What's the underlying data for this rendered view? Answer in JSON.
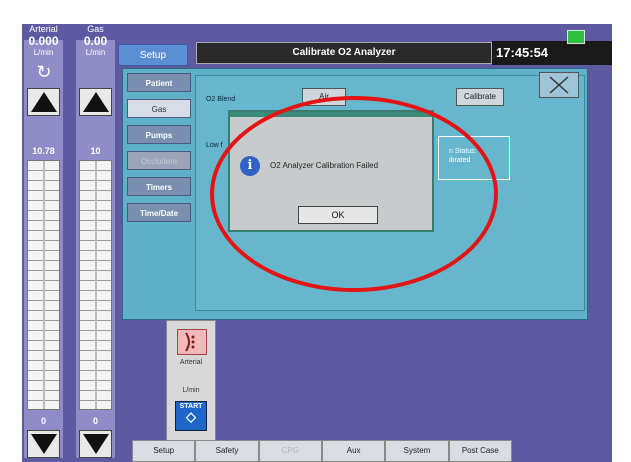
{
  "left_columns": [
    {
      "header_name": "Arterial",
      "readout": "0.000",
      "unit": "L/min",
      "value": "10.78",
      "bottom_value": "0"
    },
    {
      "header_name": "Gas",
      "readout": "0.00",
      "unit": "L/min",
      "value": "10",
      "bottom_value": "0"
    }
  ],
  "header": {
    "setup_tab": "Setup",
    "title": "Calibrate O2 Analyzer",
    "clock": "17:45:54"
  },
  "menu": [
    {
      "label": "Patient",
      "state": "normal"
    },
    {
      "label": "Gas",
      "state": "active"
    },
    {
      "label": "Pumps",
      "state": "normal"
    },
    {
      "label": "Occluders",
      "state": "disabled"
    },
    {
      "label": "Timers",
      "state": "normal"
    },
    {
      "label": "Time/Date",
      "state": "normal"
    }
  ],
  "gas_panel": {
    "o2_blender_label": "O2 Blend",
    "air_button": "Air",
    "calibrate_button": "Calibrate",
    "low_label": "Low f",
    "status_line1": "n Status:",
    "status_line2": "ibrated"
  },
  "dialog": {
    "message": "O2 Analyzer Calibration Failed",
    "ok_button": "OK",
    "icon": "info-icon"
  },
  "pump": {
    "label": "Arterial",
    "unit": "L/min",
    "start_label": "START"
  },
  "bottom_tabs": [
    {
      "label": "Setup",
      "state": "normal"
    },
    {
      "label": "Safety",
      "state": "normal"
    },
    {
      "label": "CPG",
      "state": "disabled"
    },
    {
      "label": "Aux",
      "state": "normal"
    },
    {
      "label": "System",
      "state": "normal"
    },
    {
      "label": "Post Case",
      "state": "normal"
    }
  ],
  "colors": {
    "screen_bg": "#5e5aa2",
    "content_bg": "#5fb1c9",
    "annotation": "#e41414",
    "dialog_bg": "#c7cbcc"
  }
}
